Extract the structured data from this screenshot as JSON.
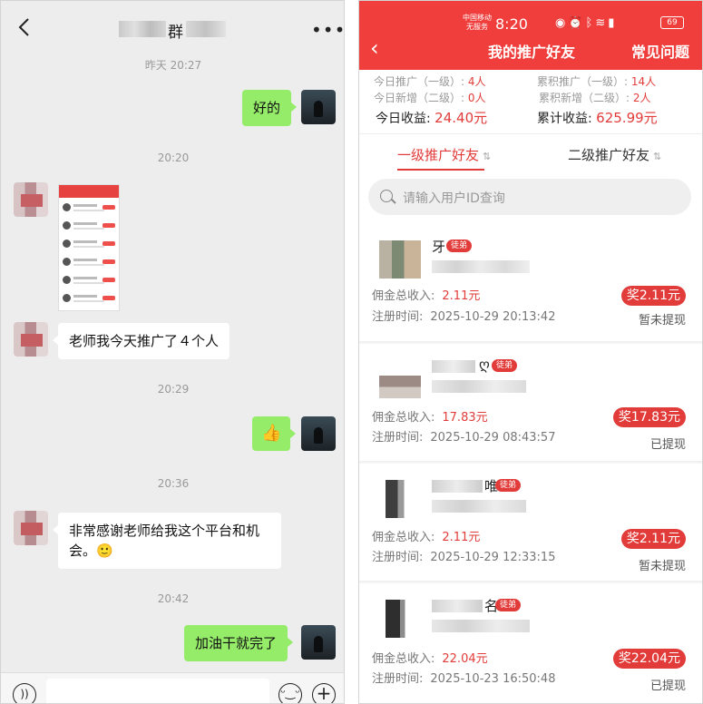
{
  "chat": {
    "title_fragment": "群",
    "messages": [
      {
        "type": "time",
        "text": "昨天 20:27"
      },
      {
        "type": "me",
        "text": "好的"
      },
      {
        "type": "time",
        "text": "20:20"
      },
      {
        "type": "time",
        "text": "20:29"
      },
      {
        "type": "other",
        "text": "老师我今天推广了４个人"
      },
      {
        "type": "me",
        "text": "👍"
      },
      {
        "type": "time",
        "text": "20:36"
      },
      {
        "type": "other",
        "text": "非常感谢老师给我这个平台和机会。🙂"
      },
      {
        "type": "time",
        "text": "20:42"
      },
      {
        "type": "me",
        "text": "加油干就完了"
      }
    ]
  },
  "app": {
    "status_bar": {
      "carrier_line1": "中国移动",
      "carrier_line2": "无服务",
      "time": "8:20",
      "battery": "69"
    },
    "title": "我的推广好友",
    "faq_label": "常见问题",
    "stats": {
      "today_l1_label": "今日推广（一级）:",
      "today_l1_value": "4人",
      "total_l1_label": "累积推广（一级）:",
      "total_l1_value": "14人",
      "today_l2_label": "今日新增（二级）:",
      "today_l2_value": "0人",
      "total_l2_label": "累积新增（二级）:",
      "total_l2_value": "2人",
      "today_income_label": "今日收益:",
      "today_income_value": "24.40元",
      "total_income_label": "累计收益:",
      "total_income_value": "625.99元"
    },
    "tabs": {
      "level1": "一级推广好友",
      "level2": "二级推广好友",
      "sort_icon": "⇅"
    },
    "search_placeholder": "请输入用户ID查询",
    "commission_label": "佣金总收入:",
    "register_label": "注册时间:",
    "tag_label": "徒弟",
    "friends": [
      {
        "name_char": "牙",
        "commission": "2.11元",
        "register_time": "2025-10-29 20:13:42",
        "reward": "奖2.11元",
        "withdraw_status": "暂未提现"
      },
      {
        "name_char": "ღ",
        "commission": "17.83元",
        "register_time": "2025-10-29 08:43:57",
        "reward": "奖17.83元",
        "withdraw_status": "已提现"
      },
      {
        "name_char": "唯",
        "commission": "2.11元",
        "register_time": "2025-10-29 12:33:15",
        "reward": "奖2.11元",
        "withdraw_status": "暂未提现"
      },
      {
        "name_char": "名",
        "commission": "22.04元",
        "register_time": "2025-10-23 16:50:48",
        "reward": "奖22.04元",
        "withdraw_status": "已提现"
      }
    ]
  }
}
